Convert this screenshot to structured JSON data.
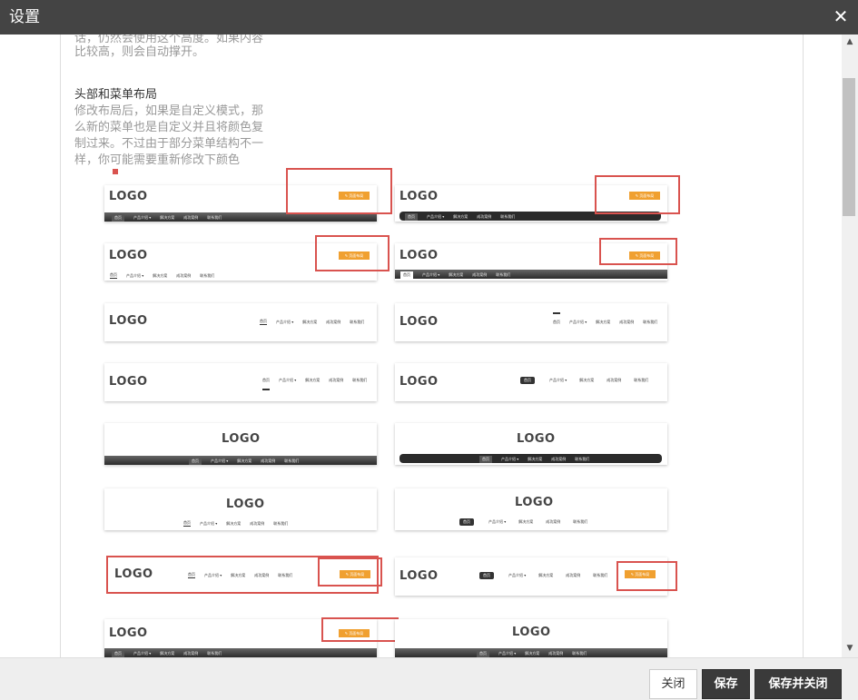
{
  "dialog": {
    "title": "设置",
    "close_glyph": "✕"
  },
  "text": {
    "intro_line1": "话，仍然会使用这个高度。如果内容",
    "intro_line2": "比较高，则会自动撑开。",
    "heading": "头部和菜单布局",
    "desc_line1": "修改布局后，如果是自定义模式，那",
    "desc_line2": "么新的菜单也是自定义并且将颜色复",
    "desc_line3": "制过来。不过由于部分菜单结构不一",
    "desc_line4": "样，你可能需要重新修改下颜色"
  },
  "thumb_text": {
    "logo": "LOGO",
    "menu": [
      "首页",
      "产品介绍 ▾",
      "解决方案",
      "成功案例",
      "联系我们"
    ],
    "edit_button": "✎ 页面布局"
  },
  "footer": {
    "close_label": "关闭",
    "save_label": "保存",
    "save_close_label": "保存并关闭"
  },
  "scrollbar": {
    "up_glyph": "▲",
    "down_glyph": "▼"
  },
  "colors": {
    "titlebar": "#444444",
    "accent_orange": "#f0a030",
    "highlight_red": "#d9534f",
    "dark_button": "#3a3a3a"
  }
}
